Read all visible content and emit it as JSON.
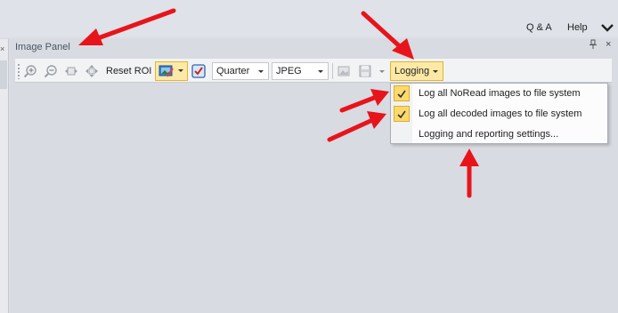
{
  "menu": {
    "qa_label": "Q & A",
    "help_label": "Help"
  },
  "panel": {
    "title": "Image Panel",
    "pin_glyph": "፨",
    "close_glyph": "×",
    "left_close_glyph": "×"
  },
  "toolbar": {
    "reset_roi_label": "Reset ROI",
    "quality_combo": {
      "value": "Quarter"
    },
    "format_combo": {
      "value": "JPEG"
    },
    "logging_label": "Logging"
  },
  "logging_menu": {
    "items": [
      {
        "label": "Log all NoRead images to file system",
        "checked": true
      },
      {
        "label": "Log all decoded images to file system",
        "checked": true
      },
      {
        "label": "Logging and reporting settings...",
        "checked": false
      }
    ]
  },
  "colors": {
    "highlight": "#fde9a6",
    "highlight_border": "#e3b430",
    "annotation_arrow": "#e8141b"
  },
  "icons": {
    "toolbar": [
      "zoom-in-icon",
      "zoom-out-icon",
      "fit-width-icon",
      "fit-all-icon",
      "image-display-icon",
      "color-check-icon",
      "export-image-icon",
      "save-icon"
    ]
  }
}
